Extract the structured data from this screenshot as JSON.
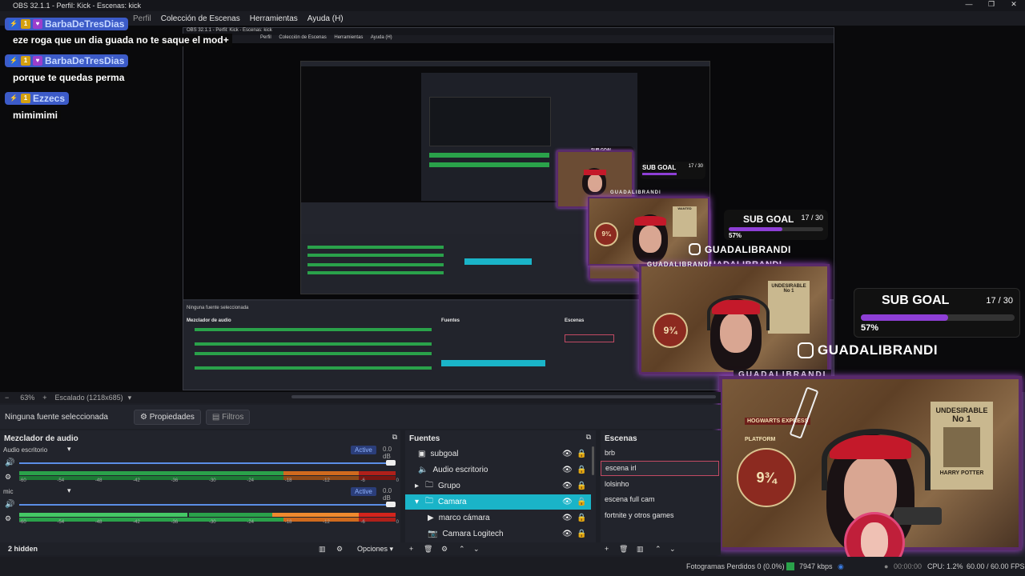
{
  "window": {
    "title": "OBS 32.1.1 - Perfil: Kick - Escenas: kick",
    "controls": [
      "—",
      "❐",
      "✕"
    ]
  },
  "menu": [
    "Perfil",
    "Colección de Escenas",
    "Herramientas",
    "Ayuda (H)"
  ],
  "nested_window": {
    "title": "OBS 32.1.1 - Perfil: Kick - Escenas: kick",
    "menu": [
      "Perfil",
      "Colección de Escenas",
      "Herramientas",
      "Ayuda (H)"
    ]
  },
  "chat": [
    {
      "user": "BarbaDeTresDias",
      "message": "eze roga que un dia guada no te saque el mod+",
      "name_color": "#c6d8ff"
    },
    {
      "user": "BarbaDeTresDias",
      "message": "porque te quedas perma",
      "name_color": "#c6d8ff"
    },
    {
      "user": "Ezzecs",
      "message": "mimimimi",
      "name_color": "#c6d8ff"
    }
  ],
  "overlay": {
    "sub_goal_title": "SUB GOAL",
    "sub_goal_count": "17 / 30",
    "sub_goal_percent": "57%",
    "sub_goal_progress": 0.57,
    "handle": "GUADALIBRANDI",
    "cam_label": "GUADALIBRANDI",
    "poster_title": "UNDESIRABLE",
    "poster_no": "No 1",
    "poster_name": "HARRY POTTER",
    "platform_word": "PLATFORM",
    "platform_num": "9¾",
    "hogwarts": "HOGWARTS EXPRESS"
  },
  "status_row": {
    "zoom": "63%",
    "scaling": "Escalado (1218x685)"
  },
  "source_bar": {
    "no_source": "Ninguna fuente seleccionada",
    "properties": "Propiedades",
    "filters": "Filtros"
  },
  "mixer": {
    "title": "Mezclador de audio",
    "tracks": [
      {
        "name": "Audio escritorio",
        "db": "0.0 dB",
        "badge": "Active"
      },
      {
        "name": "mic",
        "db": "0.0 dB",
        "badge": "Active"
      }
    ],
    "scale": [
      "-60",
      "-54",
      "-48",
      "-42",
      "-36",
      "-30",
      "-24",
      "-18",
      "-12",
      "-6",
      "0"
    ],
    "hidden": "2 hidden",
    "options": "Opciones"
  },
  "sources": {
    "title": "Fuentes",
    "items": [
      {
        "name": "subgoal",
        "icon": "scene-icon",
        "selected": false,
        "indent": 0
      },
      {
        "name": "Audio escritorio",
        "icon": "speaker-icon",
        "selected": false,
        "indent": 0
      },
      {
        "name": "Grupo",
        "icon": "folder-icon",
        "selected": false,
        "indent": 1
      },
      {
        "name": "Camara",
        "icon": "folder-icon",
        "selected": true,
        "indent": 1
      },
      {
        "name": "marco cámara",
        "icon": "play-icon",
        "selected": false,
        "indent": 2
      },
      {
        "name": "Camara Logitech",
        "icon": "camera-icon",
        "selected": false,
        "indent": 2
      }
    ]
  },
  "scenes": {
    "title": "Escenas",
    "items": [
      "brb",
      "escena irl",
      "lolsinho",
      "escena full cam",
      "fortnite y otros games",
      ""
    ],
    "selected": 1
  },
  "statusbar": {
    "dropped": "Fotogramas Perdidos 0 (0.0%)",
    "kbps": "7947 kbps",
    "rec_time": "00:00:00",
    "cpu": "CPU: 1.2%",
    "fps": "60.00 / 60.00 FPS"
  },
  "colors": {
    "accent_selected": "#1ab4c8",
    "scene_selected_border": "#c24a63",
    "meter_green": "#2aa24a",
    "meter_orange": "#d06a1e",
    "meter_red": "#b0201a",
    "sub_goal_bar": "#8e3fd6",
    "chat_badge": "#3c5bc8"
  }
}
